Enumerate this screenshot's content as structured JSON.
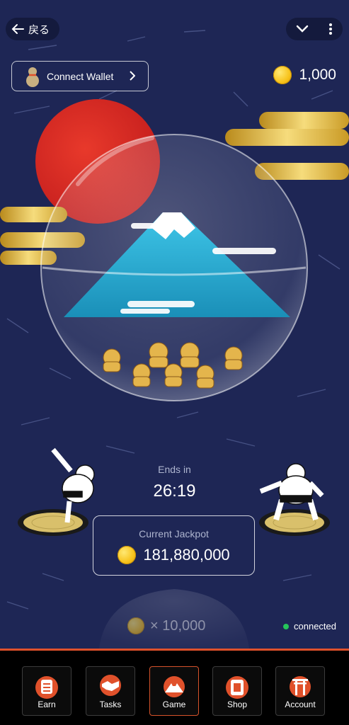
{
  "header": {
    "back_label": "戻る"
  },
  "wallet": {
    "connect_label": "Connect Wallet"
  },
  "balance": {
    "amount": "1,000"
  },
  "game": {
    "ends_label": "Ends in",
    "timer": "26:19",
    "jackpot_label": "Current Jackpot",
    "jackpot_value": "181,880,000",
    "bet_label": "× 10,000"
  },
  "status": {
    "label": "connected",
    "color": "#25c45a"
  },
  "nav": {
    "items": [
      {
        "label": "Earn",
        "icon": "lucky-bag-icon"
      },
      {
        "label": "Tasks",
        "icon": "handshake-icon"
      },
      {
        "label": "Game",
        "icon": "mount-fuji-icon",
        "active": true
      },
      {
        "label": "Shop",
        "icon": "fukubukuro-icon"
      },
      {
        "label": "Account",
        "icon": "torii-icon"
      }
    ]
  },
  "colors": {
    "background": "#1e2655",
    "accent": "#e0512b",
    "gold": "#f2c94c"
  }
}
